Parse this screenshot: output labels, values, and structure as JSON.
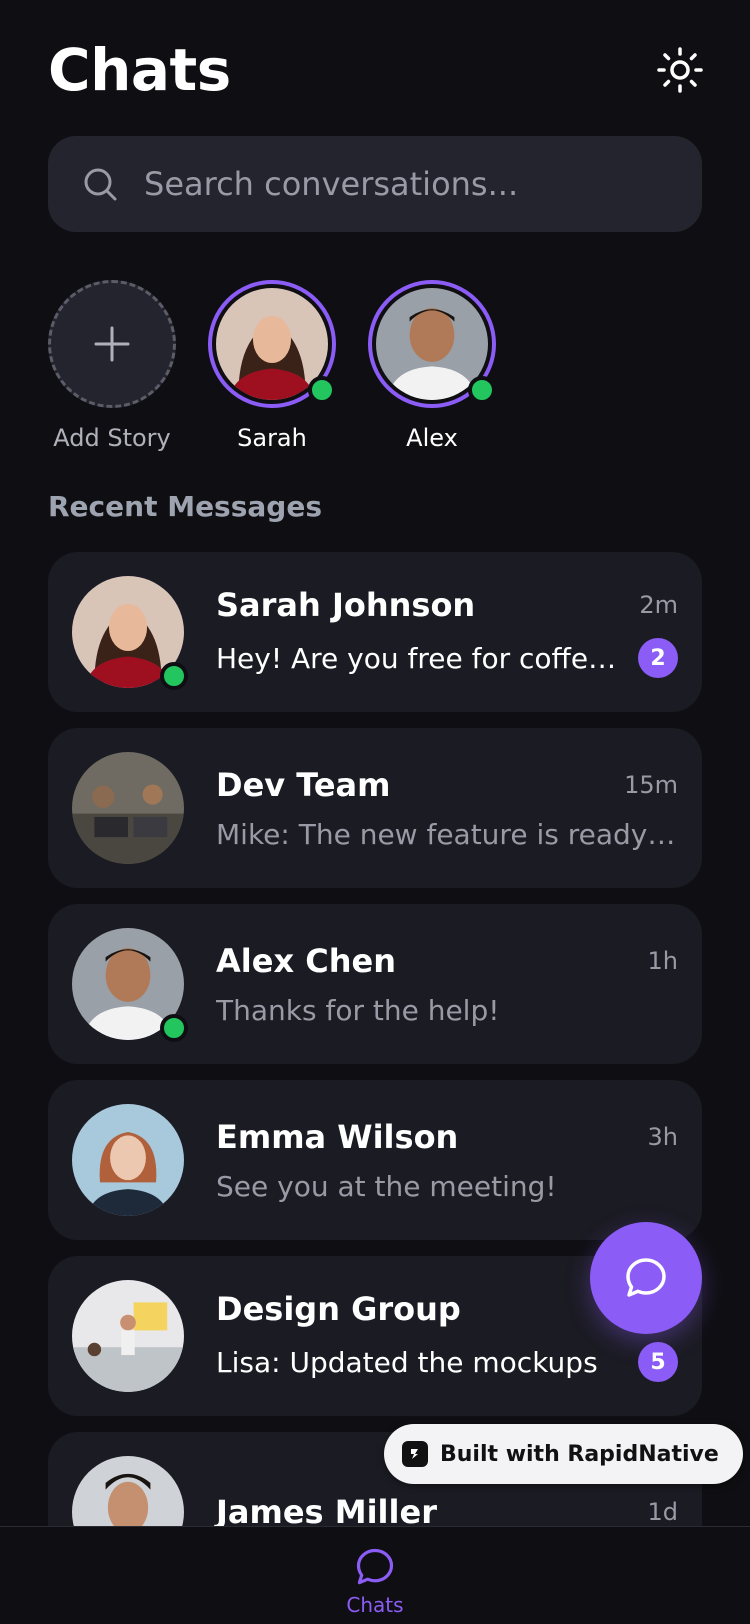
{
  "header": {
    "title": "Chats"
  },
  "search": {
    "placeholder": "Search conversations..."
  },
  "stories": [
    {
      "name": "Add Story"
    },
    {
      "name": "Sarah"
    },
    {
      "name": "Alex"
    }
  ],
  "section": {
    "title": "Recent Messages"
  },
  "conversations": [
    {
      "name": "Sarah Johnson",
      "time": "2m",
      "message": "Hey! Are you free for coffee to...",
      "unread": "2"
    },
    {
      "name": "Dev Team",
      "time": "15m",
      "message": "Mike: The new feature is ready fo..."
    },
    {
      "name": "Alex Chen",
      "time": "1h",
      "message": "Thanks for the help!"
    },
    {
      "name": "Emma Wilson",
      "time": "3h",
      "message": "See you at the meeting!"
    },
    {
      "name": "Design Group",
      "time": "",
      "message": "Lisa: Updated the mockups",
      "unread": "5"
    },
    {
      "name": "James Miller",
      "time": "1d",
      "message": ""
    }
  ],
  "built_with": "Built with RapidNative",
  "tabbar": {
    "chats_label": "Chats"
  },
  "colors": {
    "accent": "#8b5cf6",
    "online": "#22c55e",
    "background": "#0f0f13",
    "card": "#1b1b23"
  }
}
